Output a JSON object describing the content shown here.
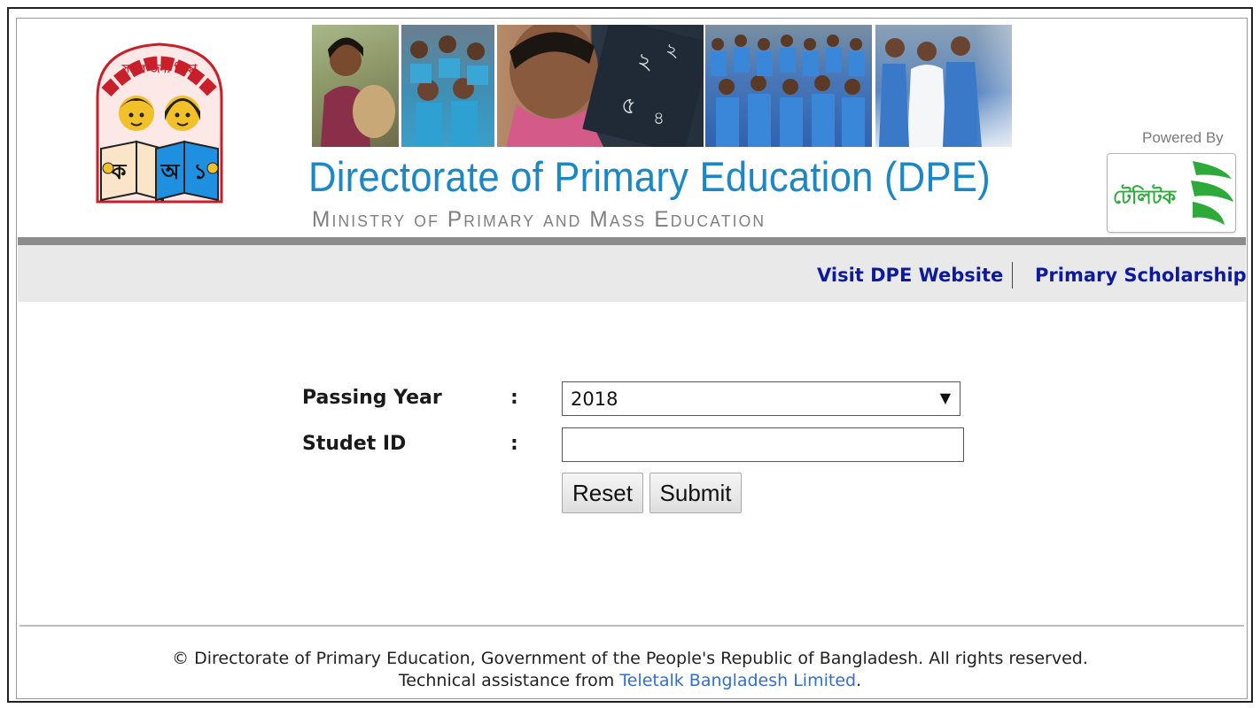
{
  "header": {
    "title": "Directorate of Primary Education (DPE)",
    "subtitle": "Ministry of Primary and Mass Education",
    "logo_text": "সবার জন্য শিক্ষা",
    "logo_book_letters": [
      "ক",
      "অ",
      "১"
    ],
    "powered_by": "Powered By",
    "teletalk_text": "টেলিটক",
    "colors": {
      "title": "#1a88c7",
      "subtitle": "#7f7f7f",
      "teletalk_green": "#2eaa3a"
    }
  },
  "nav": {
    "links": [
      {
        "label": "Visit DPE Website"
      },
      {
        "label": "Primary Scholarship"
      }
    ],
    "color": "#0d1a9e"
  },
  "form": {
    "passing_year_label": "Passing Year",
    "passing_year_colon": ":",
    "passing_year_value": "2018",
    "student_id_label": "Studet ID",
    "student_id_colon": ":",
    "student_id_value": "",
    "reset_label": "Reset",
    "submit_label": "Submit"
  },
  "footer": {
    "copyright": "© Directorate of Primary Education, Government of the People's Republic of Bangladesh. All rights reserved.",
    "tech_prefix": "Technical assistance from ",
    "tech_link": "Teletalk Bangladesh Limited",
    "tech_suffix": "."
  }
}
